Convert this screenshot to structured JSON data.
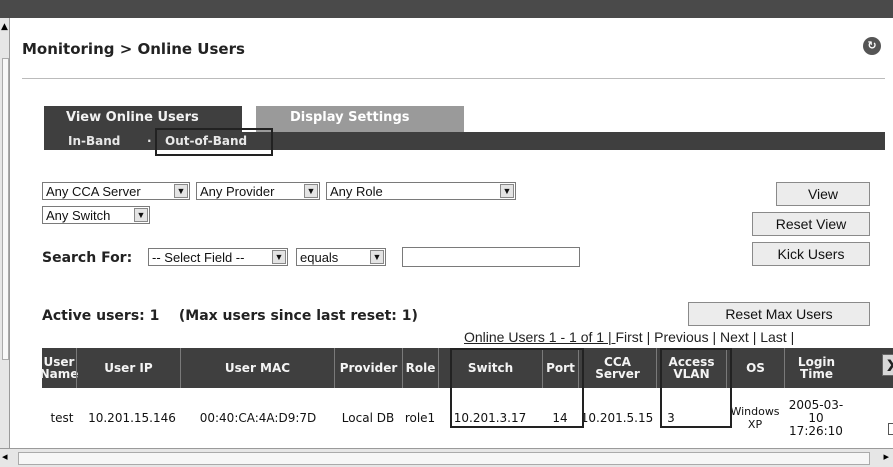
{
  "header": {
    "breadcrumb": "Monitoring > Online Users",
    "help_icon": "refresh-help-icon"
  },
  "tabs": [
    {
      "label": "View Online Users",
      "active": true
    },
    {
      "label": "Display Settings",
      "active": false
    }
  ],
  "subtabs": {
    "inband": "In-Band",
    "separator": "·",
    "outofband": "Out-of-Band",
    "selected": "Out-of-Band"
  },
  "filters": {
    "cca_server": "Any CCA Server",
    "provider": "Any Provider",
    "role": "Any Role",
    "switch": "Any Switch",
    "search_label": "Search For:",
    "search_field": "-- Select Field --",
    "operator": "equals",
    "search_value": ""
  },
  "buttons": {
    "view": "View",
    "reset_view": "Reset View",
    "kick_users": "Kick Users",
    "reset_max": "Reset Max Users"
  },
  "status": {
    "active_users": "Active users: 1    (Max users since last reset: 1)"
  },
  "pager": {
    "summary": "Online Users 1 - 1 of 1 | ",
    "first": "First",
    "previous": "Previous",
    "next": "Next",
    "last": "Last"
  },
  "table": {
    "columns": [
      "User\nName",
      "User IP",
      "User MAC",
      "Provider",
      "Role",
      "Switch",
      "Port",
      "CCA\nServer",
      "Access\nVLAN",
      "OS",
      "Login\nTime"
    ],
    "remove_header": "X",
    "rows": [
      [
        "test",
        "10.201.15.146",
        "00:40:CA:4A:D9:7D",
        "Local DB",
        "role1",
        "10.201.3.17",
        "14",
        "10.201.5.15",
        "3",
        "Windows\nXP",
        "2005-03-\n10\n17:26:10"
      ]
    ]
  },
  "colors": {
    "header_bar": "#3f3f3f",
    "inactive_tab": "#9a9a9a"
  }
}
